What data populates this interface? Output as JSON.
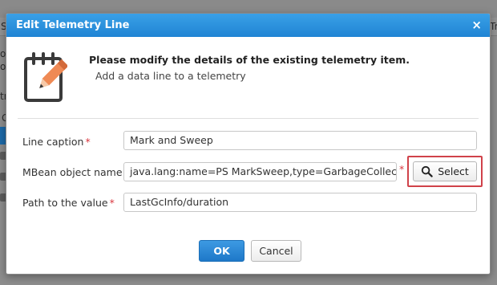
{
  "background": {
    "fragments": [
      "S",
      "on",
      "oul",
      "try",
      "G",
      "Tr"
    ]
  },
  "dialog": {
    "title": "Edit Telemetry Line",
    "close_glyph": "×",
    "intro": {
      "icon": "edit-document-icon",
      "heading": "Please modify the details of the existing telemetry item.",
      "subtext": "Add a data line to a telemetry"
    },
    "fields": {
      "caption": {
        "label": "Line caption",
        "required_mark": "*",
        "value": "Mark and Sweep"
      },
      "mbean": {
        "label": "MBean object name",
        "required_mark": "*",
        "value": "java.lang:name=PS MarkSweep,type=GarbageCollector"
      },
      "path": {
        "label": "Path to the value",
        "required_mark": "*",
        "value": "LastGcInfo/duration"
      }
    },
    "select_button": {
      "label": "Select",
      "icon": "search-icon"
    },
    "ok_label": "OK",
    "cancel_label": "Cancel"
  },
  "colors": {
    "titlebar": "#2a90dc",
    "primary_button": "#2a86d4",
    "required": "#d9363e",
    "highlight": "#d0424a"
  }
}
